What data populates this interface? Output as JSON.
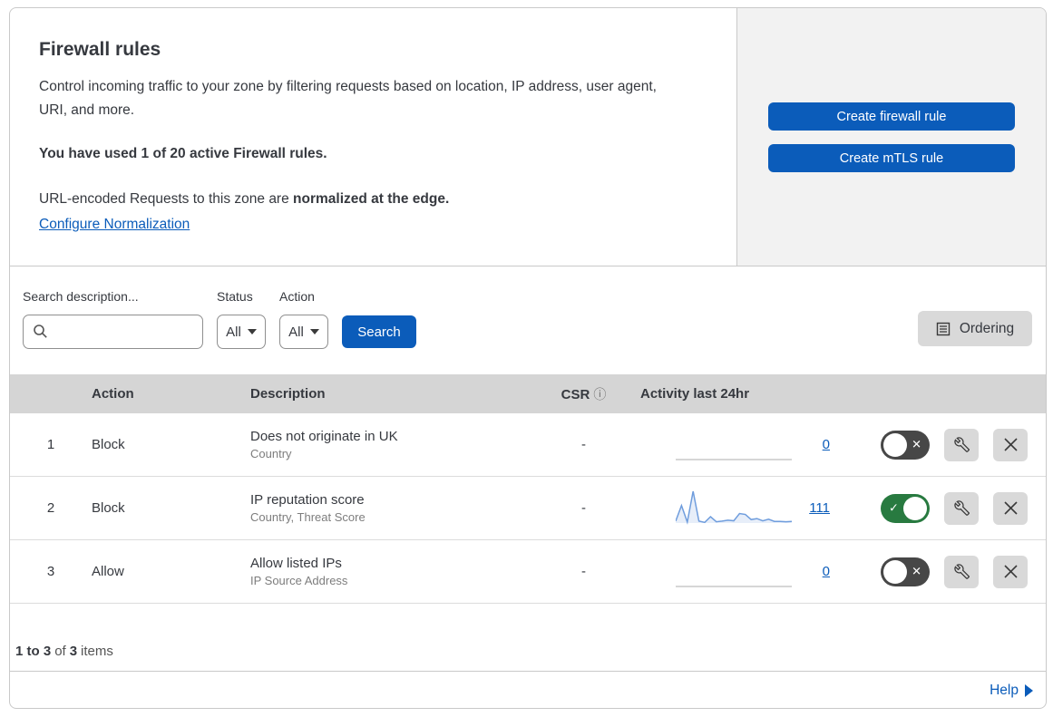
{
  "header": {
    "title": "Firewall rules",
    "description": "Control incoming traffic to your zone by filtering requests based on location, IP address, user agent, URI, and more.",
    "usage": "You have used 1 of 20 active Firewall rules.",
    "normalization_text": "URL-encoded Requests to this zone are ",
    "normalization_bold": "normalized at the edge.",
    "normalization_link": "Configure Normalization",
    "create_firewall_button": "Create firewall rule",
    "create_mtls_button": "Create mTLS rule"
  },
  "filters": {
    "search_label": "Search description...",
    "status_label": "Status",
    "status_value": "All",
    "action_label": "Action",
    "action_value": "All",
    "search_button": "Search",
    "ordering_button": "Ordering"
  },
  "table": {
    "columns": {
      "action": "Action",
      "description": "Description",
      "csr": "CSR",
      "csr_info_icon": "ⓘ",
      "activity": "Activity last 24hr"
    },
    "rows": [
      {
        "priority": "1",
        "action": "Block",
        "description": "Does not originate in UK",
        "fields": "Country",
        "csr": "-",
        "activity_count": "0",
        "enabled": false,
        "sparkline": []
      },
      {
        "priority": "2",
        "action": "Block",
        "description": "IP reputation score",
        "fields": "Country, Threat Score",
        "csr": "-",
        "activity_count": "111",
        "enabled": true,
        "sparkline": [
          6,
          55,
          3,
          100,
          6,
          2,
          20,
          4,
          6,
          9,
          7,
          30,
          27,
          11,
          14,
          7,
          12,
          5,
          5,
          4,
          5
        ]
      },
      {
        "priority": "3",
        "action": "Allow",
        "description": "Allow listed IPs",
        "fields": "IP Source Address",
        "csr": "-",
        "activity_count": "0",
        "enabled": false,
        "sparkline": []
      }
    ]
  },
  "footer": {
    "range_bold": "1 to 3",
    "of_text": "of",
    "total_bold": "3",
    "items_text": "items",
    "help_label": "Help"
  },
  "toggle_glyphs": {
    "on_check": "✓",
    "off_x": "✕"
  },
  "colors": {
    "accent_blue": "#0b5cba",
    "toggle_on_green": "#287a40",
    "toggle_off_gray": "#474747",
    "sparkline_blue": "#6f9ddd",
    "panel_gray": "#f2f2f2",
    "table_header_gray": "#d5d5d5"
  }
}
